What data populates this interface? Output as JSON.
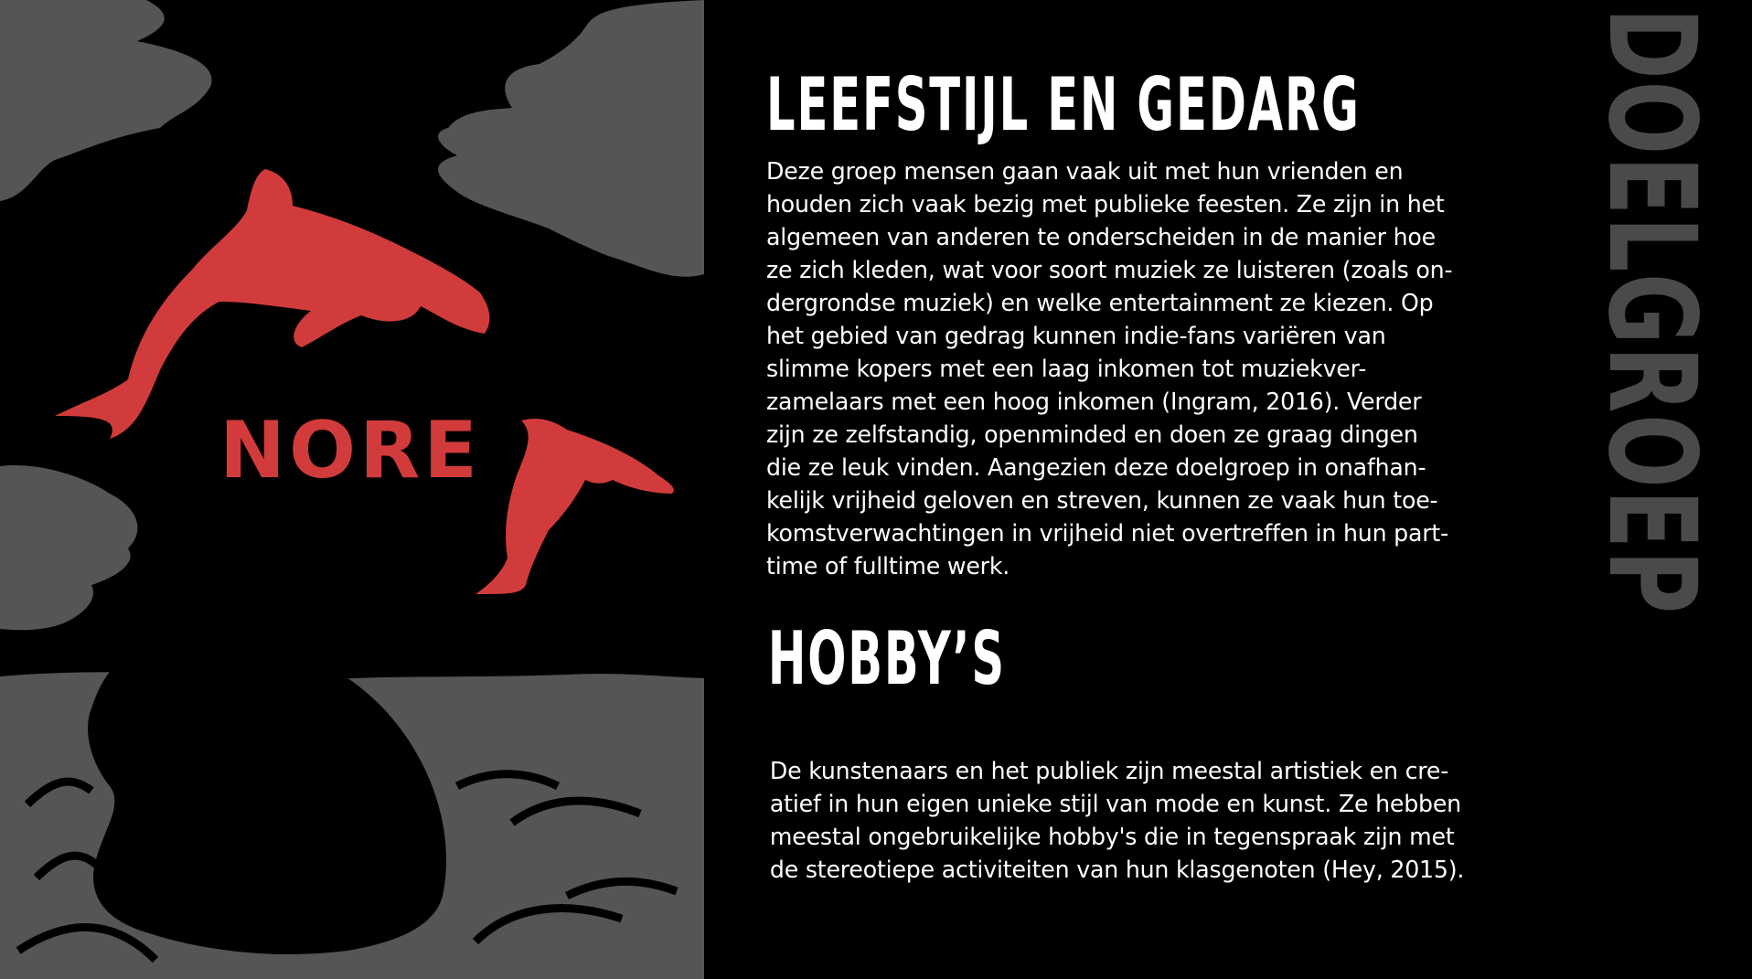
{
  "colors": {
    "background": "#000000",
    "art_gray": "#555555",
    "dolphin_red": "#d23b3b",
    "side_title": "#4a4a4a",
    "text": "#ffffff"
  },
  "art": {
    "logo_text": "NORE"
  },
  "side_title": "DOELGROEP",
  "section1": {
    "heading": "LEEFSTIJL EN GEDARG",
    "lines": [
      "Deze groep mensen gaan vaak uit met hun vrienden en",
      "houden zich vaak bezig met publieke feesten. Ze zijn in het",
      "algemeen van anderen te onderscheiden in de manier hoe",
      "ze zich kleden, wat voor soort muziek ze luisteren (zoals on-",
      "dergrondse muziek) en welke entertainment ze kiezen. Op",
      "het gebied van gedrag kunnen indie-fans variëren van",
      "slimme kopers met een laag inkomen tot muziekver-",
      "zamelaars met een hoog inkomen (Ingram, 2016). Verder",
      "zijn ze zelfstandig, openminded en doen ze graag dingen",
      "die ze leuk vinden. Aangezien deze doelgroep in onafhan-",
      "kelijk vrijheid geloven en streven, kunnen ze vaak hun toe-",
      "komstverwachtingen in vrijheid niet overtreffen in hun part-",
      "time of fulltime werk."
    ]
  },
  "section2": {
    "heading": "HOBBY’S",
    "lines": [
      "De kunstenaars en het publiek zijn meestal artistiek en cre-",
      "atief in hun eigen unieke stijl van mode en kunst. Ze hebben",
      "meestal ongebruikelijke hobby's die in tegenspraak zijn met",
      "de stereotiepe activiteiten van hun klasgenoten (Hey, 2015)."
    ]
  }
}
